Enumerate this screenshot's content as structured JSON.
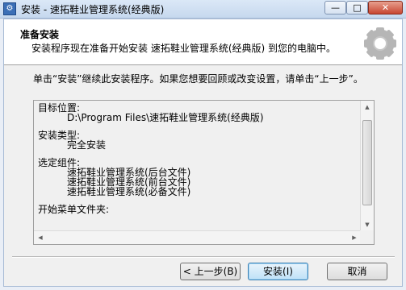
{
  "window": {
    "title": "安装 - 速拓鞋业管理系统(经典版)",
    "controls": {
      "minimize": "—",
      "maximize": "□",
      "close": "✕"
    }
  },
  "header": {
    "title": "准备安装",
    "subtitle": "安装程序现在准备开始安装 速拓鞋业管理系统(经典版) 到您的电脑中。"
  },
  "description": "单击“安装”继续此安装程序。如果您想要回顾或改变设置，请单击“上一步”。",
  "memo": {
    "dest_label": "目标位置:",
    "dest_value": "D:\\Program Files\\速拓鞋业管理系统(经典版)",
    "type_label": "安装类型:",
    "type_value": "完全安装",
    "components_label": "选定组件:",
    "components": [
      "速拓鞋业管理系统(后台文件)",
      "速拓鞋业管理系统(前台文件)",
      "速拓鞋业管理系统(必备文件)"
    ],
    "start_menu_label": "开始菜单文件夹:"
  },
  "buttons": {
    "back": "< 上一步(B)",
    "install": "安装(I)",
    "cancel": "取消"
  }
}
